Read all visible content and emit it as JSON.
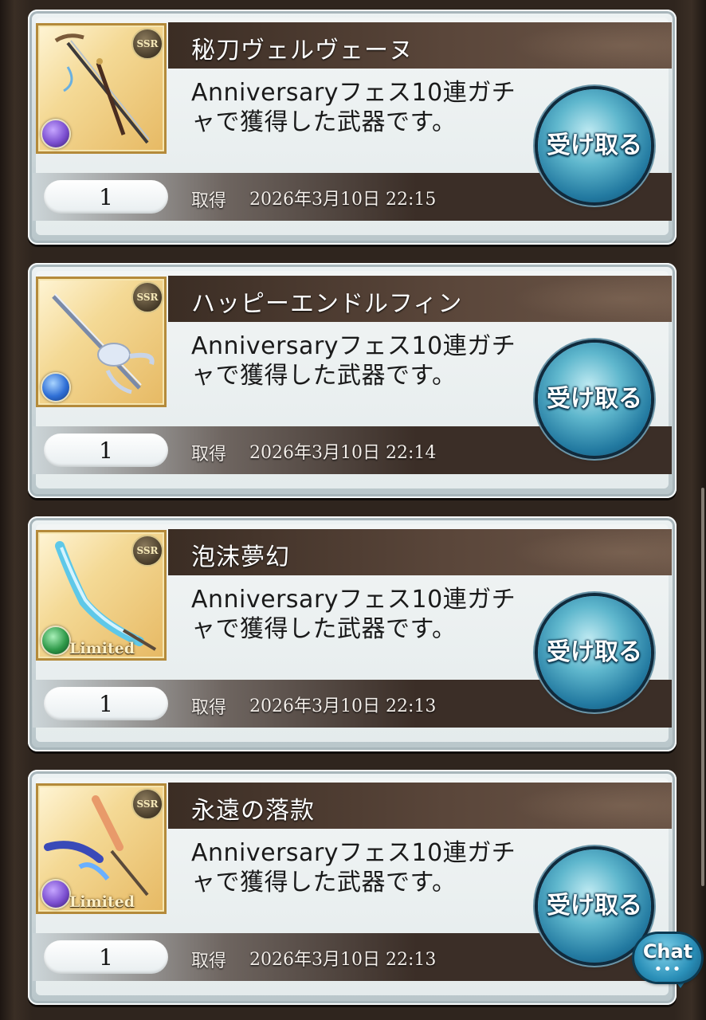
{
  "items": [
    {
      "title": "秘刀ヴェルヴェーヌ",
      "description": "Anniversaryフェス10連ガチャで獲得した武器です。",
      "count": "1",
      "acquired_label": "取得",
      "acquired_date": "2026年3月10日 22:15",
      "rarity_badge": "SSR",
      "element_icon": "dark-element-icon",
      "element_color": "#7b4fd0",
      "limited": "",
      "button_label": "受け取る"
    },
    {
      "title": "ハッピーエンドルフィン",
      "description": "Anniversaryフェス10連ガチャで獲得した武器です。",
      "count": "1",
      "acquired_label": "取得",
      "acquired_date": "2026年3月10日 22:14",
      "rarity_badge": "SSR",
      "element_icon": "water-element-icon",
      "element_color": "#2f6fd6",
      "limited": "",
      "button_label": "受け取る"
    },
    {
      "title": "泡沫夢幻",
      "description": "Anniversaryフェス10連ガチャで獲得した武器です。",
      "count": "1",
      "acquired_label": "取得",
      "acquired_date": "2026年3月10日 22:13",
      "rarity_badge": "SSR",
      "element_icon": "wind-element-icon",
      "element_color": "#2f9a4a",
      "limited": "Limited",
      "button_label": "受け取る"
    },
    {
      "title": "永遠の落款",
      "description": "Anniversaryフェス10連ガチャで獲得した武器です。",
      "count": "1",
      "acquired_label": "取得",
      "acquired_date": "2026年3月10日 22:13",
      "rarity_badge": "SSR",
      "element_icon": "dark-element-icon",
      "element_color": "#7b4fd0",
      "limited": "Limited",
      "button_label": "受け取る"
    }
  ],
  "chat": {
    "label": "Chat",
    "dots": "•••"
  }
}
